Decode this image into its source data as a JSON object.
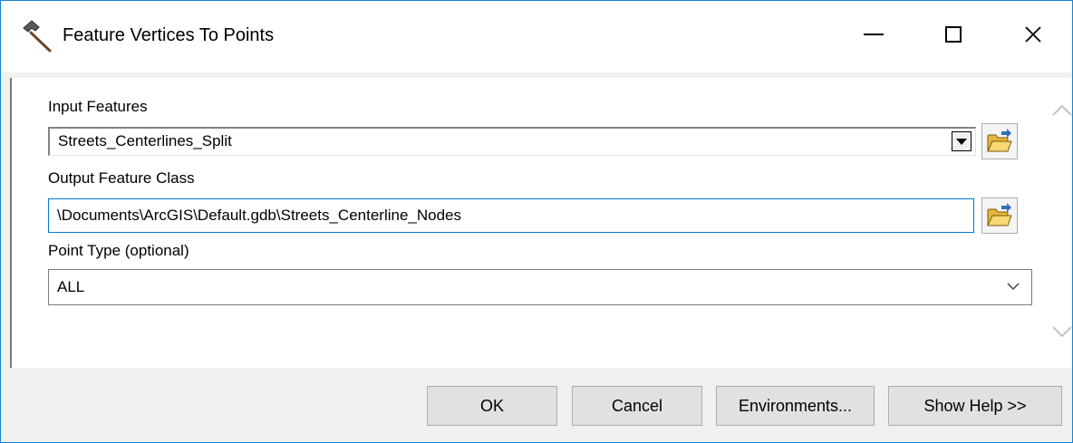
{
  "window": {
    "title": "Feature Vertices To Points",
    "app_icon": "hammer-icon",
    "controls": {
      "minimize": "minimize-icon",
      "maximize": "maximize-icon",
      "close": "close-icon",
      "close_glyph": "✕"
    }
  },
  "form": {
    "input_features": {
      "label": "Input Features",
      "value": "Streets_Centerlines_Split",
      "browse_icon": "folder-open-icon"
    },
    "output_feature_class": {
      "label": "Output Feature Class",
      "value": "\\Documents\\ArcGIS\\Default.gdb\\Streets_Centerline_Nodes",
      "browse_icon": "folder-open-icon"
    },
    "point_type": {
      "label": "Point Type (optional)",
      "value": "ALL"
    }
  },
  "buttons": {
    "ok": "OK",
    "cancel": "Cancel",
    "environments": "Environments...",
    "show_help": "Show Help >>"
  },
  "colors": {
    "accent": "#0078d7",
    "window_border": "#1883d7",
    "folder": "#f2c94c"
  }
}
